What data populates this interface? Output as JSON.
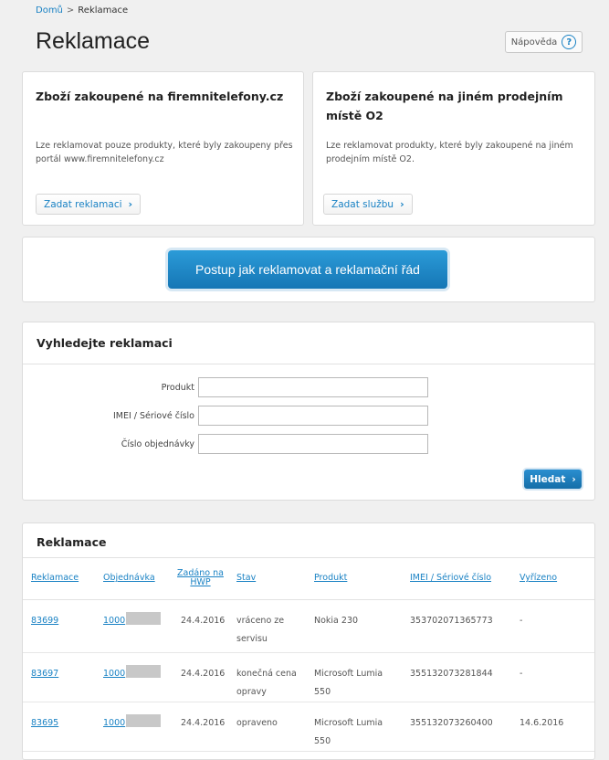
{
  "breadcrumb": {
    "home": "Domů",
    "separator": ">",
    "current": "Reklamace"
  },
  "page_title": "Reklamace",
  "help": {
    "label": "Nápověda",
    "icon": "?"
  },
  "purchase_cards": [
    {
      "title": "Zboží zakoupené na firemnitelefony.cz",
      "text": "Lze reklamovat pouze produkty, které byly zakoupeny přes portál www.firemnitelefony.cz",
      "button": "Zadat reklamaci"
    },
    {
      "title": "Zboží zakoupené na jiném prodejním místě O2",
      "text": "Lze reklamovat produkty, které byly zakoupené na jiném prodejním místě O2.",
      "button": "Zadat službu"
    }
  ],
  "procedure_button": "Postup jak reklamovat a reklamační řád",
  "search": {
    "title": "Vyhledejte reklamaci",
    "fields": [
      {
        "label": "Produkt",
        "value": ""
      },
      {
        "label": "IMEI / Sériové číslo",
        "value": ""
      },
      {
        "label": "Číslo objednávky",
        "value": ""
      }
    ],
    "button": "Hledat"
  },
  "claims": {
    "title": "Reklamace",
    "columns": [
      "Reklamace",
      "Objednávka",
      "Zadáno na HWP",
      "Stav",
      "Produkt",
      "IMEI / Sériové číslo",
      "Vyřízeno"
    ],
    "rows": [
      {
        "claim": "83699",
        "order": "1000",
        "date": "24.4.2016",
        "status": "vráceno ze servisu",
        "product": "Nokia 230",
        "imei": "353702071365773",
        "resolved": "-"
      },
      {
        "claim": "83697",
        "order": "1000",
        "date": "24.4.2016",
        "status": "konečná cena opravy",
        "product": "Microsoft Lumia 550",
        "imei": "355132073281844",
        "resolved": "-"
      },
      {
        "claim": "83695",
        "order": "1000",
        "date": "24.4.2016",
        "status": "opraveno",
        "product": "Microsoft Lumia 550",
        "imei": "355132073260400",
        "resolved": "14.6.2016"
      }
    ]
  },
  "colors": {
    "link": "#1a82c4",
    "primary_button": "#1d85c6",
    "background": "#f0f0f0"
  }
}
